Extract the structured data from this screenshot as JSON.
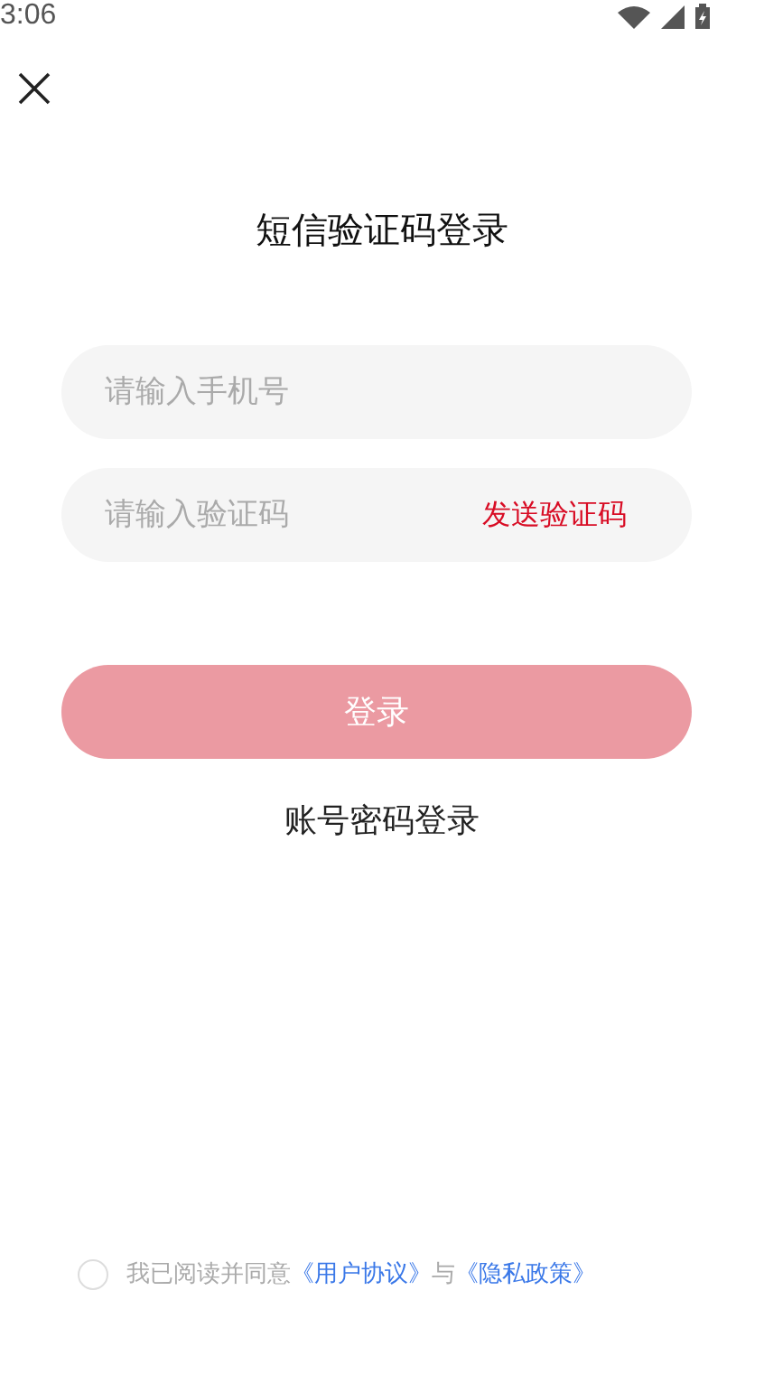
{
  "status_bar": {
    "time": "3:06"
  },
  "title": "短信验证码登录",
  "phone_field": {
    "placeholder": "请输入手机号"
  },
  "code_field": {
    "placeholder": "请输入验证码",
    "send_code": "发送验证码"
  },
  "login_button": {
    "label": "登录",
    "disabled": true
  },
  "password_login": "账号密码登录",
  "agreement": {
    "checked": false,
    "prefix": "我已阅读并同意",
    "terms": "《用户协议》",
    "joiner": "与",
    "privacy": "《隐私政策》"
  }
}
